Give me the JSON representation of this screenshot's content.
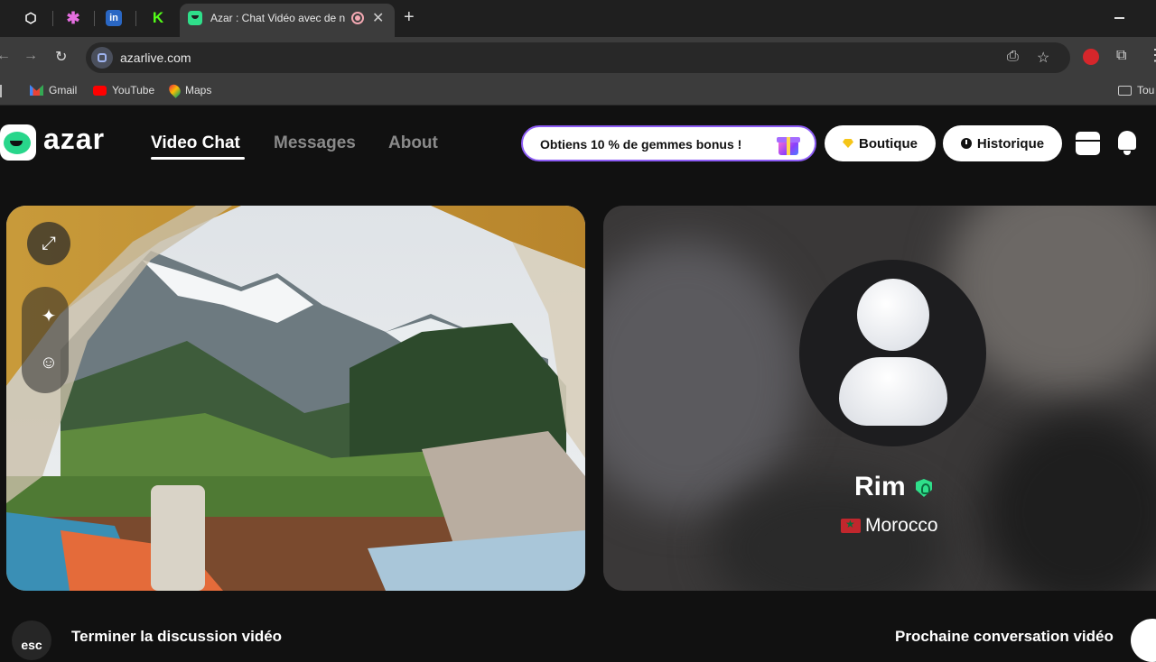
{
  "browser": {
    "tabs": [
      {
        "icon": "github-icon"
      },
      {
        "icon": "slack-icon"
      },
      {
        "icon": "linkedin-icon",
        "glyph": "in"
      },
      {
        "icon": "kick-icon",
        "glyph": "K"
      },
      {
        "icon": "azar-icon",
        "title": "Azar : Chat Vidéo avec de n",
        "active": true
      }
    ],
    "url": "azarlive.com",
    "bookmarks": [
      {
        "label": "Gmail",
        "icon": "gmail-icon"
      },
      {
        "label": "YouTube",
        "icon": "youtube-icon"
      },
      {
        "label": "Maps",
        "icon": "maps-icon"
      }
    ],
    "bookmark_folder": "Tou"
  },
  "app": {
    "logo": "azar",
    "nav": [
      {
        "label": "Video Chat",
        "active": true
      },
      {
        "label": "Messages",
        "active": false
      },
      {
        "label": "About",
        "active": false
      }
    ],
    "promo": "Obtiens 10 % de gemmes bonus !",
    "shop": "Boutique",
    "history": "Historique",
    "colors": {
      "brand": "#2fdf8a",
      "promo_border": "#8d5cf6",
      "flag": "#c1272d"
    }
  },
  "remote_user": {
    "name": "Rim",
    "verified": true,
    "country": "Morocco"
  },
  "actions": {
    "esc_key": "esc",
    "end": "Terminer la discussion vidéo",
    "next": "Prochaine conversation vidéo"
  }
}
